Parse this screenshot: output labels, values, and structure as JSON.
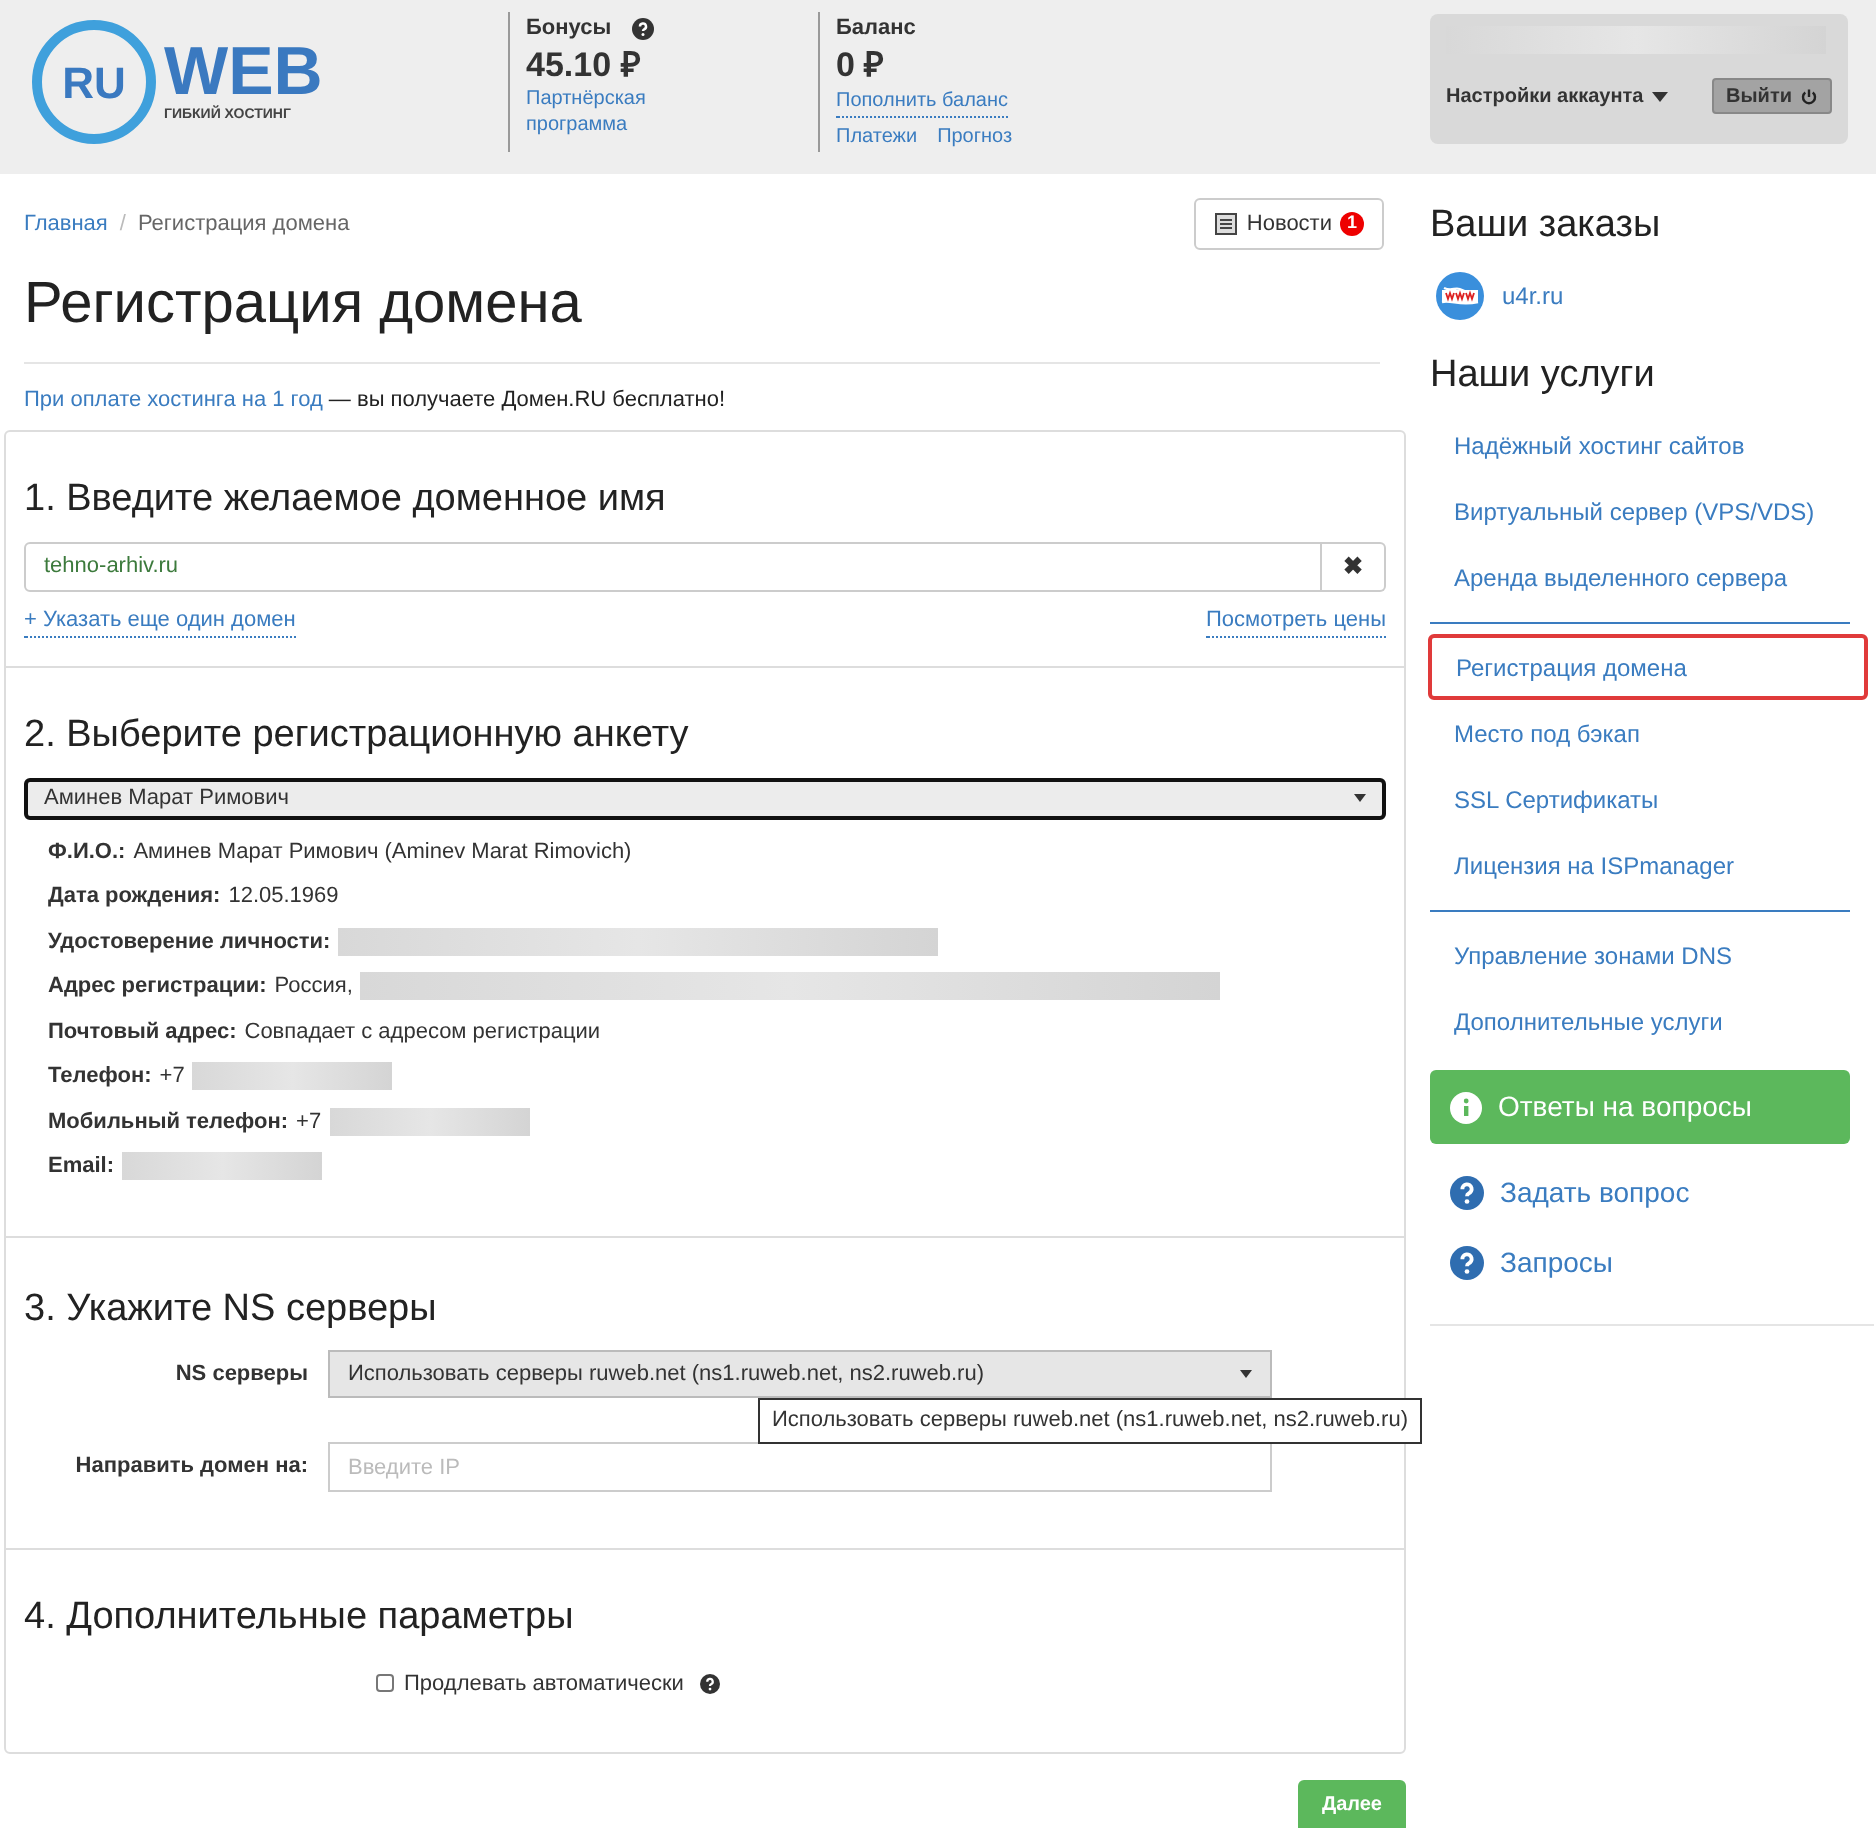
{
  "header": {
    "logo": {
      "mark": "RU",
      "word": "WEB",
      "tagline": "ГИБКИЙ ХОСТИНГ"
    },
    "bonus": {
      "label": "Бонусы",
      "amount": "45.10 ₽",
      "link": "Партнёрская программа"
    },
    "balance": {
      "label": "Баланс",
      "amount": "0 ₽",
      "links": [
        "Пополнить баланс",
        "Платежи",
        "Прогноз"
      ]
    },
    "account": {
      "settings": "Настройки аккаунта",
      "logout": "Выйти"
    }
  },
  "breadcrumb_separator": "/",
  "breadcrumbs": [
    {
      "label": "Главная",
      "link": true
    },
    {
      "label": "Регистрация домена",
      "link": false
    }
  ],
  "news_button": {
    "label": "Новости",
    "count": "1"
  },
  "page_title": "Регистрация домена",
  "promo": {
    "link": "При оплате хостинга на 1 год",
    "rest": " — вы получаете Домен.RU бесплатно!"
  },
  "step1": {
    "title": "1. Введите желаемое доменное имя",
    "domain": "tehno-arhiv.ru",
    "clear": "✖",
    "add_link": "+ Указать еще один домен",
    "prices_link": "Посмотреть цены"
  },
  "step2": {
    "title": "2. Выберите регистрационную анкету",
    "profile": "Аминев Марат Римович",
    "details": [
      {
        "label": "Ф.И.О.:",
        "value": "Аминев Марат Римович (Aminev Marat Rimovich)",
        "redacted": false
      },
      {
        "label": "Дата рождения:",
        "value": "12.05.1969",
        "redacted": false
      },
      {
        "label": "Удостоверение личности:",
        "redacted": true
      },
      {
        "label": "Адрес регистрации:",
        "value": "Россия,",
        "redacted": true
      },
      {
        "label": "Почтовый адрес:",
        "value": "Совпадает с адресом регистрации",
        "redacted": false
      },
      {
        "label": "Телефон:",
        "value": "+7",
        "redacted": true
      },
      {
        "label": "Мобильный телефон:",
        "value": "+7",
        "redacted": true
      },
      {
        "label": "Email:",
        "redacted": true
      }
    ]
  },
  "step3": {
    "title": "3. Укажите NS серверы",
    "ns_label": "NS серверы",
    "ns_value": "Использовать серверы ruweb.net (ns1.ruweb.net, ns2.ruweb.ru)",
    "tooltip": "Использовать серверы ruweb.net (ns1.ruweb.net, ns2.ruweb.ru)",
    "ip_label": "Направить домен на:",
    "ip_placeholder": "Введите IP"
  },
  "step4": {
    "title": "4. Дополнительные параметры",
    "auto_renew": {
      "label": "Продлевать автоматически",
      "checked": false
    }
  },
  "next_button": "Далее",
  "sidebar": {
    "orders_title": "Ваши заказы",
    "orders": [
      "u4r.ru"
    ],
    "services_title": "Наши услуги",
    "service_groups": [
      [
        {
          "label": "Надёжный хостинг сайтов",
          "selected": false
        },
        {
          "label": "Виртуальный сервер (VPS/VDS)",
          "selected": false
        },
        {
          "label": "Аренда выделенного сервера",
          "selected": false
        }
      ],
      [
        {
          "label": "Регистрация домена",
          "selected": true
        },
        {
          "label": "Место под бэкап",
          "selected": false
        },
        {
          "label": "SSL Сертификаты",
          "selected": false
        },
        {
          "label": "Лицензия на ISPmanager",
          "selected": false
        }
      ],
      [
        {
          "label": "Управление зонами DNS",
          "selected": false
        },
        {
          "label": "Дополнительные услуги",
          "selected": false
        }
      ]
    ],
    "faq_button": "Ответы на вопросы",
    "help_links": [
      "Задать вопрос",
      "Запросы"
    ]
  }
}
